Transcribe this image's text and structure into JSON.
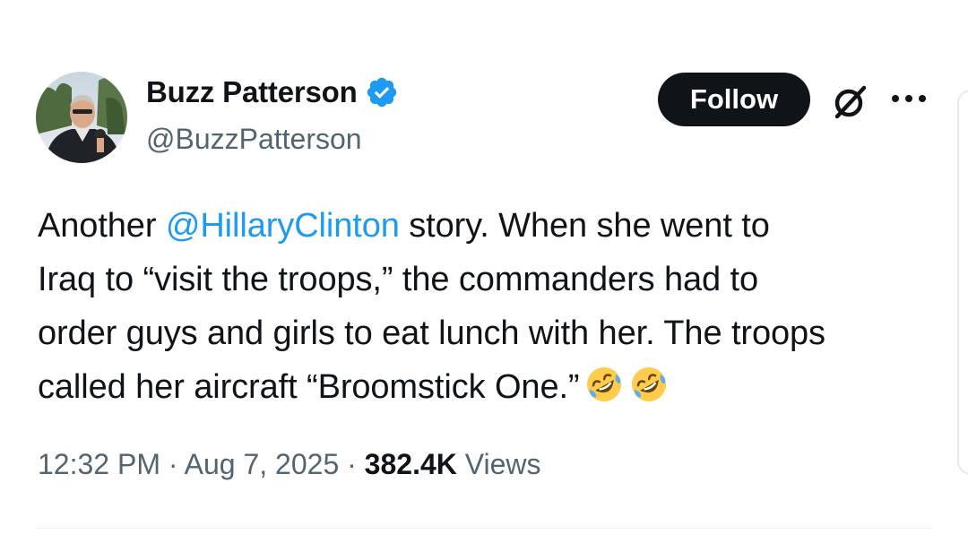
{
  "author": {
    "display_name": "Buzz Patterson",
    "handle": "@BuzzPatterson",
    "verified": true,
    "verified_color": "#1d9bf0",
    "avatar_icon": "profile-photo"
  },
  "actions": {
    "follow_label": "Follow",
    "grok_icon": "grok-icon",
    "more_icon": "more-dots-icon"
  },
  "tweet": {
    "lines": [
      {
        "pre": "Another ",
        "mention": "@HillaryClinton",
        "post": " story. When she went to"
      },
      {
        "text": "Iraq to “visit the troops,” the commanders had to"
      },
      {
        "text": "order guys and girls to eat lunch with her. The troops"
      },
      {
        "text": "called her aircraft “Broomstick One.”"
      }
    ],
    "emojis": [
      "rolling-on-floor-laughing",
      "rolling-on-floor-laughing"
    ],
    "mention_color": "#1d9bf0"
  },
  "meta": {
    "time": "12:32 PM",
    "sep1": " · ",
    "date": "Aug 7, 2025",
    "sep2": " · ",
    "views_count": "382.4K",
    "views_label": " Views"
  }
}
